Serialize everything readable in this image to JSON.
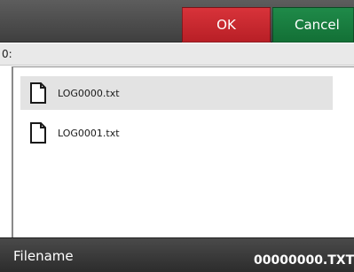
{
  "toolbar": {
    "ok_label": "OK",
    "cancel_label": "Cancel",
    "ok_color": "#c8282f",
    "cancel_color": "#187d3f"
  },
  "path": "0:",
  "files": [
    {
      "name": "LOG0000.txt",
      "icon": "document-icon",
      "selected": true
    },
    {
      "name": "LOG0001.txt",
      "icon": "document-icon",
      "selected": false
    }
  ],
  "footer": {
    "label": "Filename",
    "value": "00000000.TXT"
  }
}
